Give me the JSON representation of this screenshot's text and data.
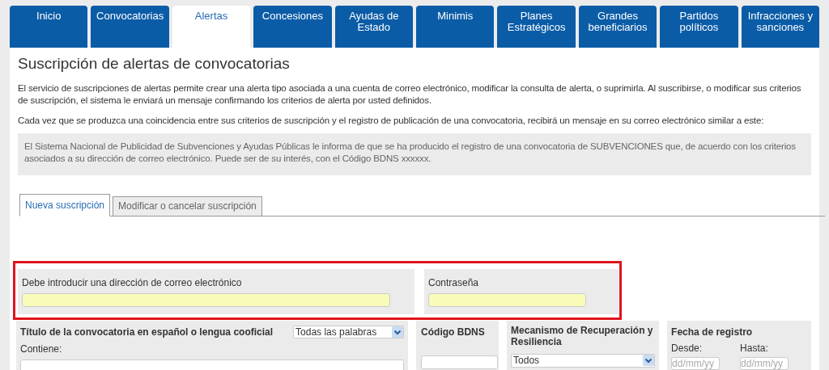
{
  "nav_tabs": [
    {
      "label": "Inicio",
      "selected": false
    },
    {
      "label": "Convocatorias",
      "selected": false
    },
    {
      "label": "Alertas",
      "selected": true
    },
    {
      "label": "Concesiones",
      "selected": false
    },
    {
      "label": "Ayudas de Estado",
      "selected": false
    },
    {
      "label": "Minimis",
      "selected": false
    },
    {
      "label": "Planes Estratégicos",
      "selected": false
    },
    {
      "label": "Grandes beneficiarios",
      "selected": false
    },
    {
      "label": "Partidos políticos",
      "selected": false
    },
    {
      "label": "Infracciones y sanciones",
      "selected": false
    }
  ],
  "title": "Suscripción de alertas de convocatorias",
  "paragraphs": [
    "El servicio de suscripciones de alertas permite crear una alerta tipo asociada a una cuenta de correo electrónico, modificar la consulta de alerta, o suprimirla. Al suscribirse, o modificar sus criterios de suscripción, el sistema le enviará un mensaje confirmando los criterios de alerta por usted definidos.",
    "Cada vez que se produzca una coincidencia entre sus criterios de suscripción y el registro de publicación de una convocatoria, recibirá un mensaje en su correo electrónico similar a este:"
  ],
  "sample_message": "El Sistema Nacional de Publicidad de Subvenciones y Ayudas Públicas le informa de que se ha producido el registro de una convocatoria de SUBVENCIONES que, de acuerdo con los criterios asociados a su dirección de correo electrónico. Puede ser de su interés, con el Código BDNS xxxxxx.",
  "form_tabs": [
    {
      "label": "Nueva suscripción",
      "selected": true
    },
    {
      "label": "Modificar o cancelar suscripción",
      "selected": false
    }
  ],
  "email": {
    "label": "Debe introducir una dirección de correo electrónico"
  },
  "password": {
    "label": "Contraseña"
  },
  "title_filter": {
    "label": "Título de la convocatoria en español o lengua cooficial",
    "mode": "Todas las palabras",
    "contains_label": "Contiene:"
  },
  "bdns": {
    "label": "Código BDNS"
  },
  "mechanism": {
    "label": "Mecanismo de Recuperación y Resiliencia",
    "value": "Todos"
  },
  "date": {
    "label": "Fecha de registro",
    "from_label": "Desde:",
    "from_placeholder": "dd/mm/yy",
    "to_label": "Hasta:",
    "to_placeholder": "dd/mm/yy"
  }
}
